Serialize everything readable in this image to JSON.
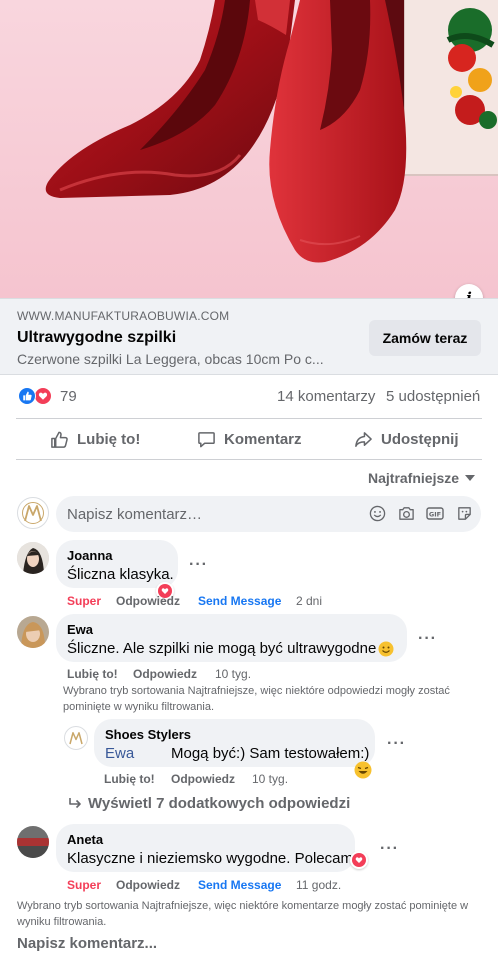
{
  "link_preview": {
    "domain": "WWW.MANUFAKTURAOBUWIA.COM",
    "title": "Ultrawygodne szpilki",
    "description": "Czerwone szpilki La Leggera, obcas 10cm Po c...",
    "cta_label": "Zamów teraz",
    "info_label": "i"
  },
  "stats": {
    "reaction_count": "79",
    "comments": "14 komentarzy",
    "shares": "5 udostępnień"
  },
  "actions": {
    "like": "Lubię to!",
    "comment": "Komentarz",
    "share": "Udostępnij"
  },
  "sort": {
    "label": "Najtrafniejsze"
  },
  "composer": {
    "placeholder": "Napisz komentarz…"
  },
  "comments": [
    {
      "author": "Joanna",
      "text": "Śliczna klasyka.",
      "reaction_label": "Super",
      "reply_label": "Odpowiedz",
      "message_label": "Send Message",
      "time": "2 dni"
    },
    {
      "author": "Ewa",
      "text": "Śliczne. Ale szpilki nie mogą być ultrawygodne",
      "like_label": "Lubię to!",
      "reply_label": "Odpowiedz",
      "time": "10 tyg.",
      "note": "Wybrano tryb sortowania Najtrafniejsze, więc niektóre odpowiedzi mogły zostać pominięte w wyniku filtrowania.",
      "reply": {
        "author": "Shoes Stylers",
        "mention": "Ewa",
        "text": "Mogą być:) Sam testowałem:)",
        "like_label": "Lubię to!",
        "reply_label": "Odpowiedz",
        "time": "10 tyg."
      },
      "more_replies": "Wyświetl 7 dodatkowych odpowiedzi"
    },
    {
      "author": "Aneta",
      "text": "Klasyczne i nieziemsko wygodne. Polecam",
      "reaction_label": "Super",
      "reply_label": "Odpowiedz",
      "message_label": "Send Message",
      "time": "11 godz."
    }
  ],
  "footer_note": "Wybrano tryb sortowania Najtrafniejsze, więc niektóre komentarze mogły zostać pominięte w wyniku filtrowania.",
  "write_comment": "Napisz komentarz...",
  "colors": {
    "brand_blue": "#1877f2",
    "love_red": "#f33e58",
    "secondary_text": "#65676b",
    "bubble_bg": "#f0f2f5",
    "hero_pink": "#f7cfd8"
  },
  "icons": {
    "like": "thumbs-up-icon",
    "comment": "speech-bubble-icon",
    "share": "share-arrow-icon",
    "sort": "caret-down-icon",
    "composer": [
      "smiley-icon",
      "camera-icon",
      "gif-icon",
      "sticker-icon"
    ]
  }
}
